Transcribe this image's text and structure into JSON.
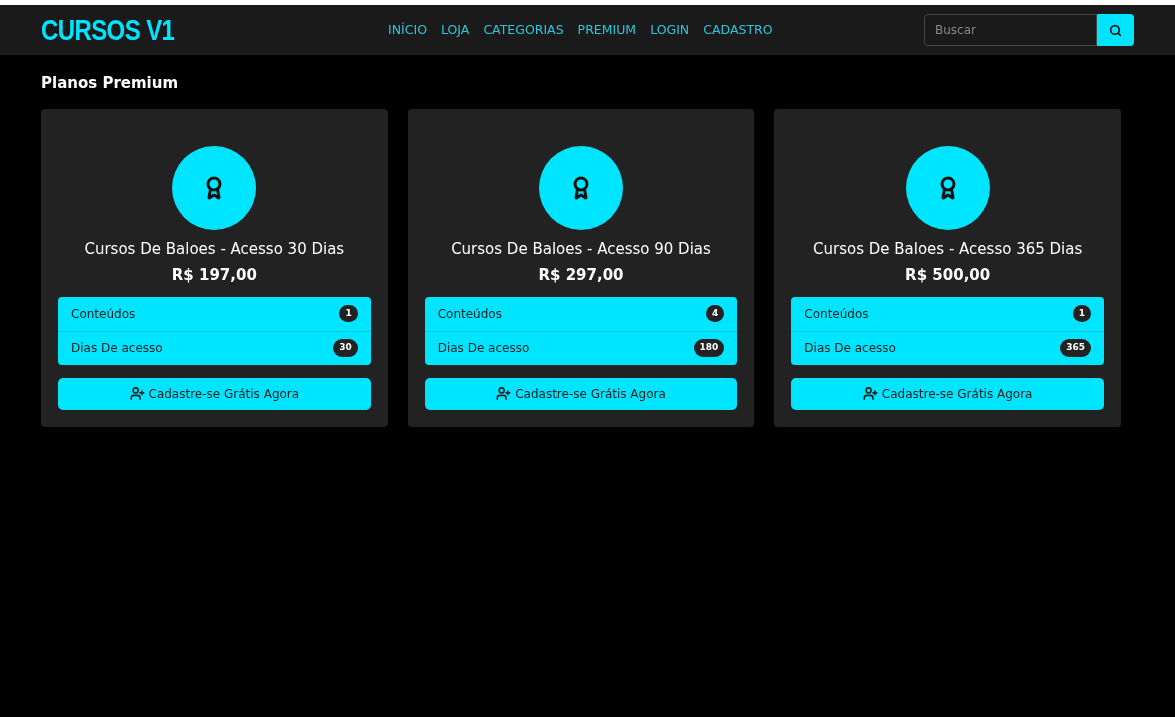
{
  "brand": "CURSOS V1",
  "nav": [
    "INÍCIO",
    "LOJA",
    "CATEGORIAS",
    "PREMIUM",
    "LOGIN",
    "CADASTRO"
  ],
  "search": {
    "placeholder": "Buscar"
  },
  "heading": "Planos Premium",
  "plans": [
    {
      "title": "Cursos De Baloes - Acesso 30 Dias",
      "price": "R$ 197,00",
      "stats": [
        {
          "label": "Conteúdos",
          "count": "1"
        },
        {
          "label": "Dias De acesso",
          "count": "30"
        }
      ],
      "button": "Cadastre-se Grátis Agora"
    },
    {
      "title": "Cursos De Baloes - Acesso 90 Dias",
      "price": "R$ 297,00",
      "stats": [
        {
          "label": "Conteúdos",
          "count": "4"
        },
        {
          "label": "Dias De acesso",
          "count": "180"
        }
      ],
      "button": "Cadastre-se Grátis Agora"
    },
    {
      "title": "Cursos De Baloes - Acesso 365 Dias",
      "price": "R$ 500,00",
      "stats": [
        {
          "label": "Conteúdos",
          "count": "1"
        },
        {
          "label": "Dias De acesso",
          "count": "365"
        }
      ],
      "button": "Cadastre-se Grátis Agora"
    }
  ]
}
